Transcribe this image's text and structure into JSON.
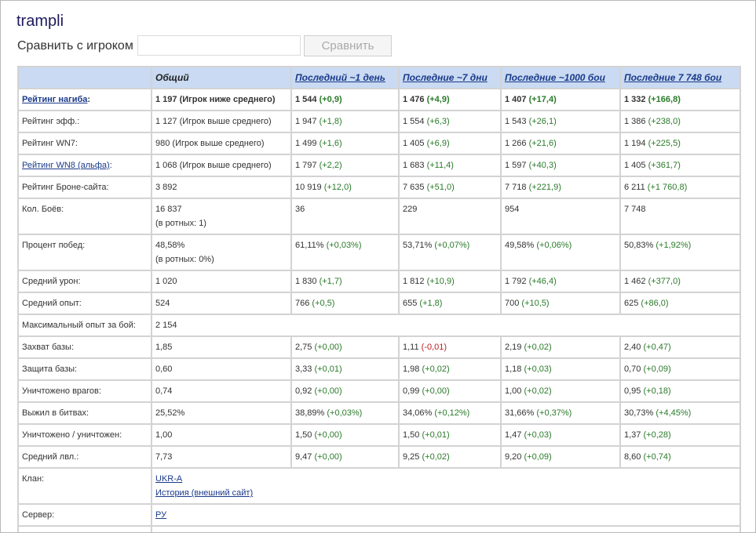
{
  "player_name": "trampli",
  "compare": {
    "label": "Сравнить с игроком",
    "input_value": "",
    "button_label": "Сравнить"
  },
  "table": {
    "headers": {
      "general": "Общий",
      "day1": "Последний ~1 день",
      "day7": "Последние ~7 дни",
      "b1000": "Последние ~1000 бои",
      "b7748": "Последние 7 748 бои"
    },
    "rows": {
      "nagib": {
        "label": "Рейтинг нагиба",
        "label_suffix": ":",
        "general": "1 197 (Игрок ниже среднего)",
        "day1": "1 544",
        "day1_delta": "(+0,9)",
        "day7": "1 476",
        "day7_delta": "(+4,9)",
        "b1000": "1 407",
        "b1000_delta": "(+17,4)",
        "b7748": "1 332",
        "b7748_delta": "(+166,8)"
      },
      "eff": {
        "label": "Рейтинг эфф.:",
        "general": "1 127 (Игрок выше среднего)",
        "day1": "1 947",
        "day1_delta": "(+1,8)",
        "day7": "1 554",
        "day7_delta": "(+6,3)",
        "b1000": "1 543",
        "b1000_delta": "(+26,1)",
        "b7748": "1 386",
        "b7748_delta": "(+238,0)"
      },
      "wn7": {
        "label": "Рейтинг WN7:",
        "general": "980 (Игрок выше среднего)",
        "day1": "1 499",
        "day1_delta": "(+1,6)",
        "day7": "1 405",
        "day7_delta": "(+6,9)",
        "b1000": "1 266",
        "b1000_delta": "(+21,6)",
        "b7748": "1 194",
        "b7748_delta": "(+225,5)"
      },
      "wn8": {
        "label": "Рейтинг WN8 (альфа)",
        "label_suffix": ":",
        "general": "1 068 (Игрок выше среднего)",
        "day1": "1 797",
        "day1_delta": "(+2,2)",
        "day7": "1 683",
        "day7_delta": "(+11,4)",
        "b1000": "1 597",
        "b1000_delta": "(+40,3)",
        "b7748": "1 405",
        "b7748_delta": "(+361,7)"
      },
      "armor": {
        "label": "Рейтинг Броне-сайта:",
        "general": "3 892",
        "day1": "10 919",
        "day1_delta": "(+12,0)",
        "day7": "7 635",
        "day7_delta": "(+51,0)",
        "b1000": "7 718",
        "b1000_delta": "(+221,9)",
        "b7748": "6 211",
        "b7748_delta": "(+1 760,8)"
      },
      "battles": {
        "label": "Кол. Боёв:",
        "general": "16 837",
        "general_sub": "(в ротных: 1)",
        "day1": "36",
        "day7": "229",
        "b1000": "954",
        "b7748": "7 748"
      },
      "winrate": {
        "label": "Процент побед:",
        "general": "48,58%",
        "general_sub": "(в ротных: 0%)",
        "day1": "61,11%",
        "day1_delta": "(+0,03%)",
        "day7": "53,71%",
        "day7_delta": "(+0,07%)",
        "b1000": "49,58%",
        "b1000_delta": "(+0,06%)",
        "b7748": "50,83%",
        "b7748_delta": "(+1,92%)"
      },
      "damage": {
        "label": "Средний урон:",
        "general": "1 020",
        "day1": "1 830",
        "day1_delta": "(+1,7)",
        "day7": "1 812",
        "day7_delta": "(+10,9)",
        "b1000": "1 792",
        "b1000_delta": "(+46,4)",
        "b7748": "1 462",
        "b7748_delta": "(+377,0)"
      },
      "xp": {
        "label": "Средний опыт:",
        "general": "524",
        "day1": "766",
        "day1_delta": "(+0,5)",
        "day7": "655",
        "day7_delta": "(+1,8)",
        "b1000": "700",
        "b1000_delta": "(+10,5)",
        "b7748": "625",
        "b7748_delta": "(+86,0)"
      },
      "maxxp": {
        "label": "Максимальный опыт за бой:",
        "general": "2 154"
      },
      "capture": {
        "label": "Захват базы:",
        "general": "1,85",
        "day1": "2,75",
        "day1_delta": "(+0,00)",
        "day7": "1,11",
        "day7_delta": "(-0,01)",
        "b1000": "2,19",
        "b1000_delta": "(+0,02)",
        "b7748": "2,40",
        "b7748_delta": "(+0,47)"
      },
      "defense": {
        "label": "Защита базы:",
        "general": "0,60",
        "day1": "3,33",
        "day1_delta": "(+0,01)",
        "day7": "1,98",
        "day7_delta": "(+0,02)",
        "b1000": "1,18",
        "b1000_delta": "(+0,03)",
        "b7748": "0,70",
        "b7748_delta": "(+0,09)"
      },
      "frags": {
        "label": "Уничтожено врагов:",
        "general": "0,74",
        "day1": "0,92",
        "day1_delta": "(+0,00)",
        "day7": "0,99",
        "day7_delta": "(+0,00)",
        "b1000": "1,00",
        "b1000_delta": "(+0,02)",
        "b7748": "0,95",
        "b7748_delta": "(+0,18)"
      },
      "survived": {
        "label": "Выжил в битвах:",
        "general": "25,52%",
        "day1": "38,89%",
        "day1_delta": "(+0,03%)",
        "day7": "34,06%",
        "day7_delta": "(+0,12%)",
        "b1000": "31,66%",
        "b1000_delta": "(+0,37%)",
        "b7748": "30,73%",
        "b7748_delta": "(+4,45%)"
      },
      "kd": {
        "label": "Уничтожено / уничтожен:",
        "general": "1,00",
        "day1": "1,50",
        "day1_delta": "(+0,00)",
        "day7": "1,50",
        "day7_delta": "(+0,01)",
        "b1000": "1,47",
        "b1000_delta": "(+0,03)",
        "b7748": "1,37",
        "b7748_delta": "(+0,28)"
      },
      "level": {
        "label": "Средний лвл.:",
        "general": "7,73",
        "day1": "9,47",
        "day1_delta": "(+0,00)",
        "day7": "9,25",
        "day7_delta": "(+0,02)",
        "b1000": "9,20",
        "b1000_delta": "(+0,09)",
        "b7748": "8,60",
        "b7748_delta": "(+0,74)"
      },
      "clan": {
        "label": "Клан:",
        "clan_link": "UKR-A",
        "history_link": "История (внешний сайт)"
      },
      "server": {
        "label": "Сервер:",
        "server_link": "РУ"
      }
    }
  },
  "colors": {
    "header_bg": "#c9daf2",
    "positive": "#2a7a2a",
    "negative": "#c02020",
    "link": "#1a3a8a"
  }
}
